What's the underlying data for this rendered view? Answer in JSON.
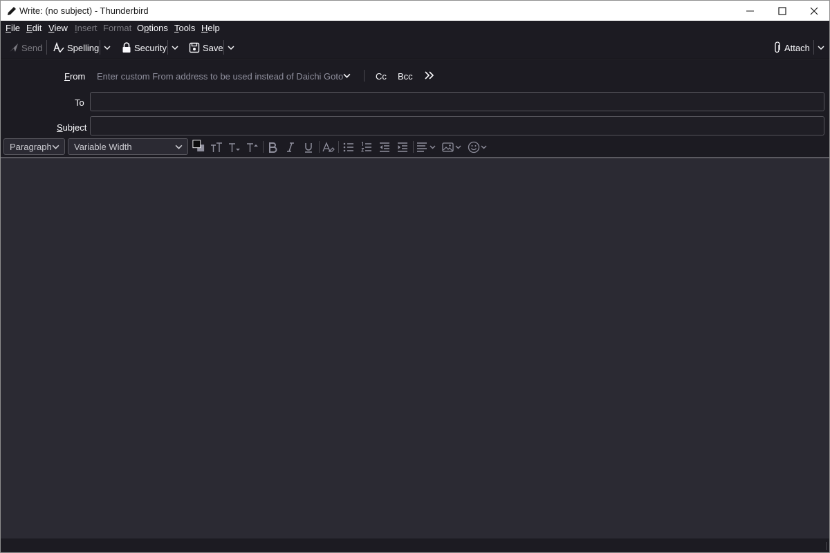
{
  "window": {
    "title": "Write: (no subject) - Thunderbird",
    "app_icon": "pencil-icon",
    "controls": [
      "minimize-icon",
      "maximize-icon",
      "close-icon"
    ]
  },
  "menubar": {
    "items": [
      {
        "label": "File",
        "access": "F",
        "rest": "ile",
        "disabled": false
      },
      {
        "label": "Edit",
        "access": "E",
        "rest": "dit",
        "disabled": false
      },
      {
        "label": "View",
        "access": "V",
        "rest": "iew",
        "disabled": false
      },
      {
        "label": "Insert",
        "access": "I",
        "rest": "nsert",
        "disabled": true
      },
      {
        "label": "Format",
        "access": "F",
        "rest": "ormat",
        "disabled": true
      },
      {
        "label": "Options",
        "access": "p",
        "pre": "O",
        "rest": "tions",
        "disabled": false
      },
      {
        "label": "Tools",
        "access": "T",
        "rest": "ools",
        "disabled": false
      },
      {
        "label": "Help",
        "access": "H",
        "rest": "elp",
        "disabled": false
      }
    ]
  },
  "toolbar": {
    "send_label": "Send",
    "spelling_label": "Spelling",
    "security_label": "Security",
    "save_label": "Save",
    "attach_label": "Attach"
  },
  "header": {
    "from_label_access": "F",
    "from_label_rest": "rom",
    "from_placeholder": "Enter custom From address to be used instead of Daichi Goto ·",
    "cc_label": "Cc",
    "bcc_label": "Bcc",
    "to_label": "To",
    "to_value": "",
    "subject_label_access": "S",
    "subject_label_rest": "ubject",
    "subject_value": ""
  },
  "formatbar": {
    "paragraph_format": "Paragraph",
    "font_family": "Variable Width"
  },
  "colors": {
    "chrome_bg": "#1c1b22",
    "editor_bg": "#2b2a33",
    "text": "#fbfbfe",
    "muted_text": "#8f8f9d",
    "disabled_text": "#7d7c83",
    "titlebar_bg": "#ffffff"
  }
}
